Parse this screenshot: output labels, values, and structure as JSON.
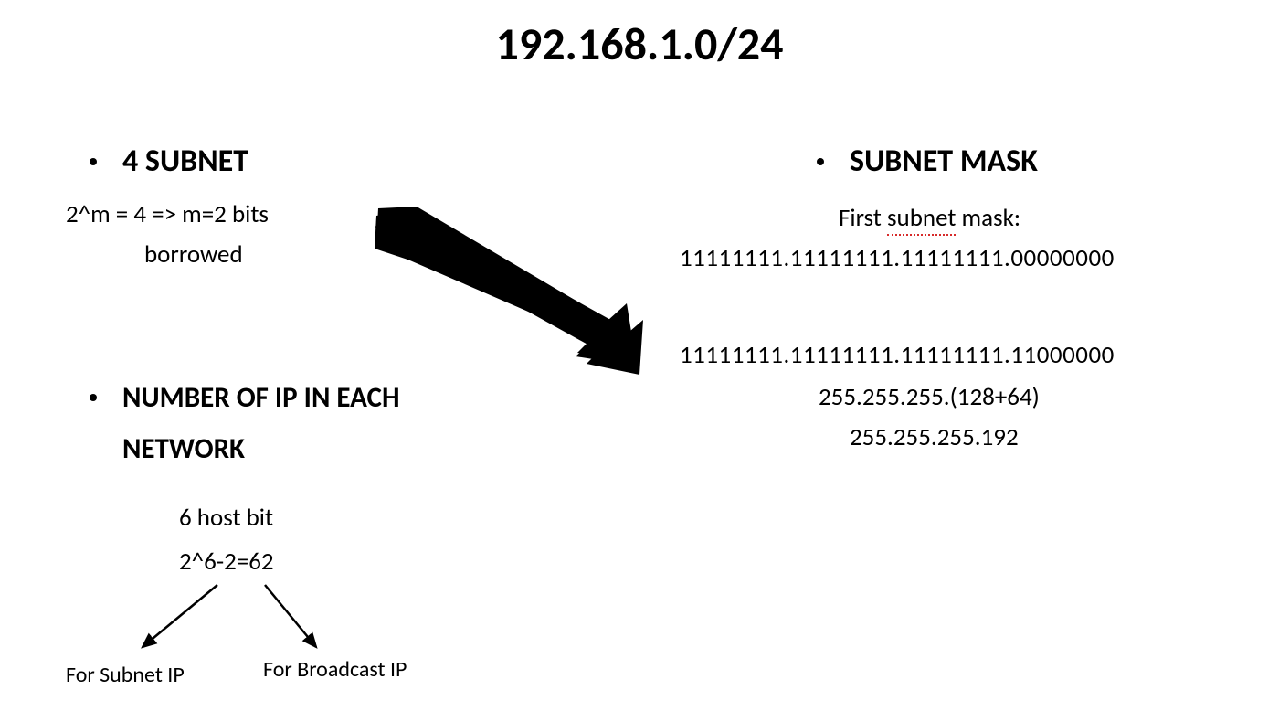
{
  "title": "192.168.1.0/24",
  "left": {
    "subnet_heading": "4 SUBNET",
    "subnet_calc_line1": "2^m = 4   => m=2 bits",
    "subnet_calc_line2": "borrowed",
    "ip_heading_line1": "NUMBER OF IP IN EACH",
    "ip_heading_line2": "NETWORK",
    "host_bit": "6 host bit",
    "host_calc": "2^6-2=62",
    "branch_left": "For Subnet IP",
    "branch_right": "For Broadcast IP"
  },
  "right": {
    "mask_heading": "SUBNET MASK",
    "first_mask_label_pre": "First ",
    "first_mask_label_mid": "subnet",
    "first_mask_label_post": " mask:",
    "mask_binary_1": "11111111.11111111.11111111.00000000",
    "mask_binary_2": "11111111.11111111.11111111.11000000",
    "mask_decimal_sum": "255.255.255.(128+64)",
    "mask_decimal": "255.255.255.192"
  }
}
